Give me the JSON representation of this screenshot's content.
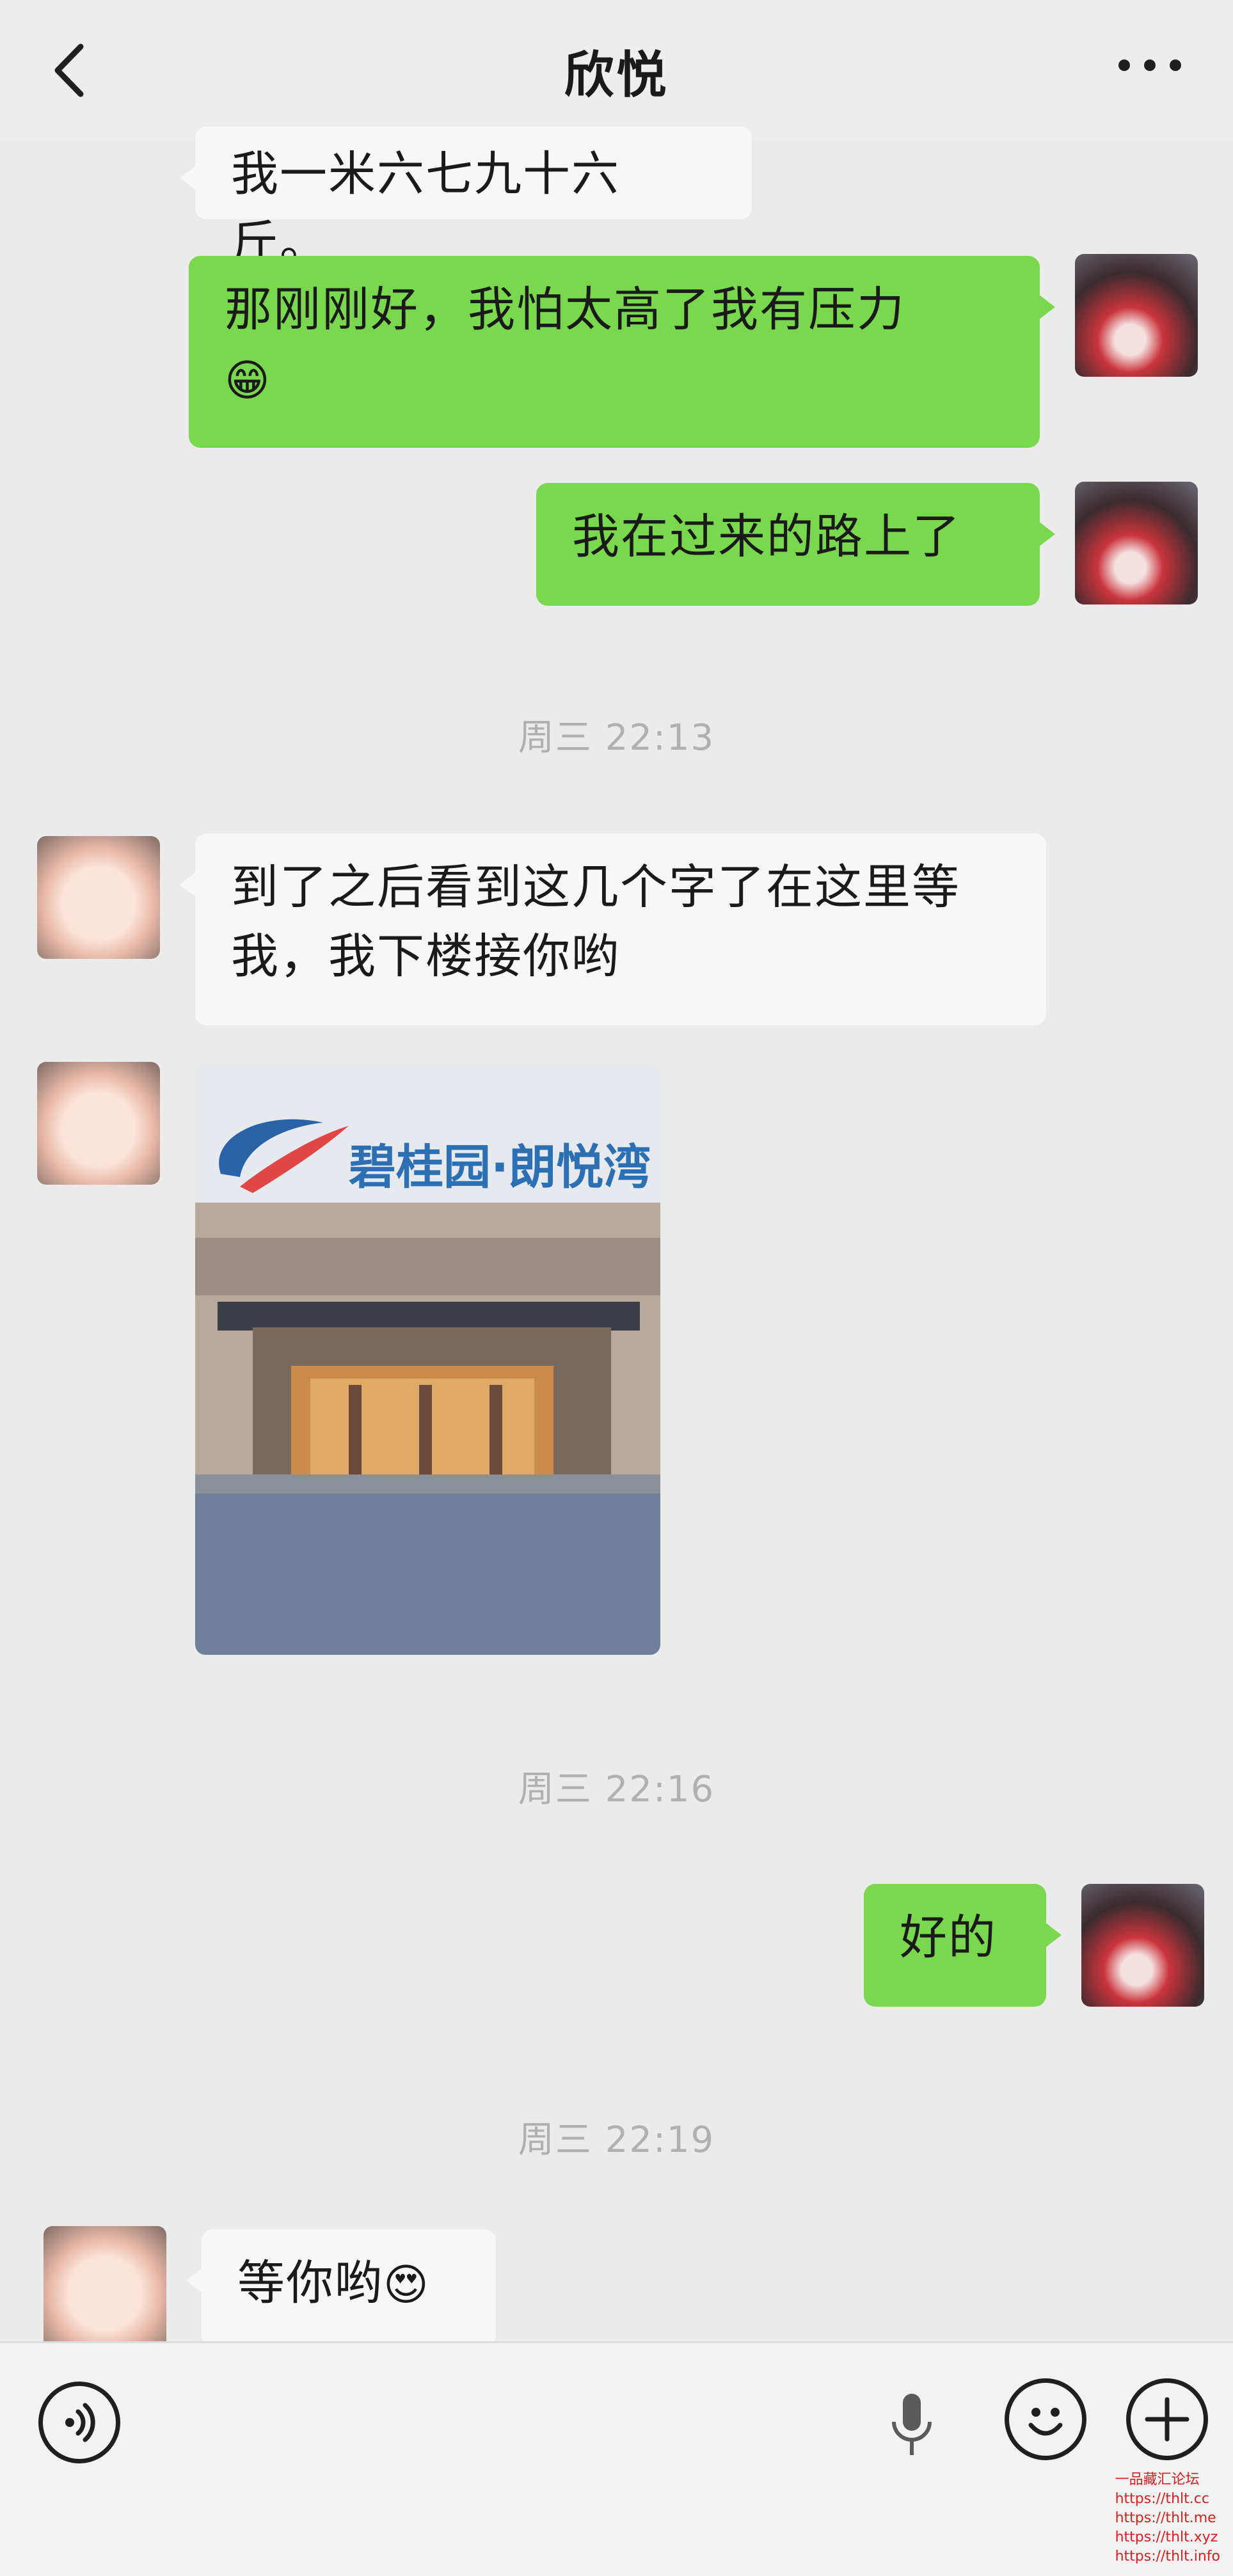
{
  "header": {
    "title": "欣悦",
    "back_icon": "chevron-left-icon",
    "more_icon": "more-dots-icon"
  },
  "messages": [
    {
      "side": "in",
      "text": "我一米六七九十六斤。"
    },
    {
      "side": "out",
      "text": "那刚刚好，我怕太高了我有压力",
      "emoji": "😁"
    },
    {
      "side": "out",
      "text": "我在过来的路上了"
    },
    {
      "timestamp": "周三 22:13"
    },
    {
      "side": "in",
      "text": "到了之后看到这几个字了在这里等我，我下楼接你哟"
    },
    {
      "side": "in",
      "type": "image",
      "sign_text": "碧桂园·朗悦湾"
    },
    {
      "timestamp": "周三 22:16"
    },
    {
      "side": "out",
      "text": "好的"
    },
    {
      "timestamp": "周三 22:19"
    },
    {
      "side": "in",
      "text": "等你哟",
      "emoji": "😍"
    }
  ],
  "input_bar": {
    "voice_icon": "voice-toggle-icon",
    "mic_icon": "microphone-icon",
    "emoji_icon": "emoji-face-icon",
    "plus_icon": "plus-icon"
  },
  "watermark": {
    "line1": "一品藏汇论坛",
    "line2": "https://thlt.cc",
    "line3": "https://thlt.me",
    "line4": "https://thlt.xyz",
    "line5": "https://thlt.info"
  },
  "colors": {
    "outgoing_bubble": "#79d84e",
    "incoming_bubble": "#f7f7f7",
    "background": "#ebebeb",
    "timestamp": "#b0b0b0"
  }
}
